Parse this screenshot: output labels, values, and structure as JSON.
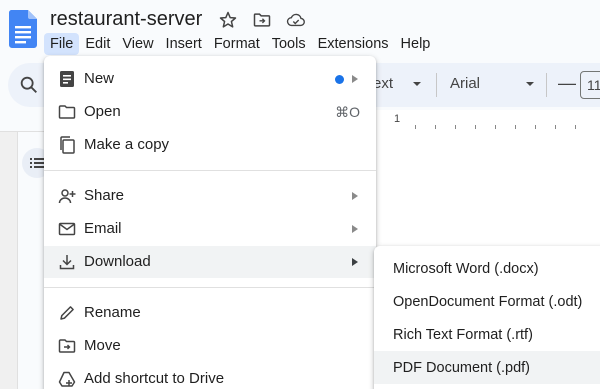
{
  "document": {
    "title": "restaurant-server"
  },
  "menubar": [
    "File",
    "Edit",
    "View",
    "Insert",
    "Format",
    "Tools",
    "Extensions",
    "Help"
  ],
  "toolbar": {
    "style_value": "ext",
    "font_value": "Arial",
    "minus_label": "—",
    "font_size": "11"
  },
  "ruler": {
    "number": "1"
  },
  "file_menu": {
    "new": {
      "label": "New"
    },
    "open": {
      "label": "Open",
      "shortcut": "⌘O"
    },
    "make_copy": {
      "label": "Make a copy"
    },
    "share": {
      "label": "Share"
    },
    "email": {
      "label": "Email"
    },
    "download": {
      "label": "Download"
    },
    "rename": {
      "label": "Rename"
    },
    "move": {
      "label": "Move"
    },
    "add_shortcut": {
      "label": "Add shortcut to Drive"
    }
  },
  "download_menu": {
    "docx": "Microsoft Word (.docx)",
    "odt": "OpenDocument Format (.odt)",
    "rtf": "Rich Text Format (.rtf)",
    "pdf": "PDF Document (.pdf)"
  },
  "colors": {
    "accent": "#1a73e8",
    "docs_blue": "#4285f4",
    "menu_active": "#d3e3fd"
  }
}
